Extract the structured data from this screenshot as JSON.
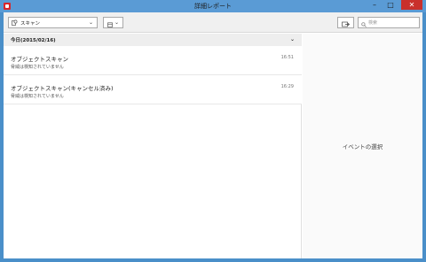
{
  "window": {
    "title": "詳細レポート",
    "minimize": "–",
    "maximize": "□",
    "close": "✕"
  },
  "toolbar": {
    "scan_filter": "スキャン",
    "search_placeholder": "検索"
  },
  "events": {
    "group_label": "今日(2015/02/16)",
    "items": [
      {
        "title": "オブジェクトスキャン",
        "detail": "脅威は検知されていません",
        "time": "16:51"
      },
      {
        "title": "オブジェクトスキャン(キャンセル済み)",
        "detail": "脅威は検知されていません",
        "time": "16:29"
      }
    ]
  },
  "detail_pane": {
    "placeholder": "イベントの選択"
  },
  "colors": {
    "titlebar": "#5a9bd5",
    "close": "#c9302c",
    "accent_red": "#d8262b"
  }
}
